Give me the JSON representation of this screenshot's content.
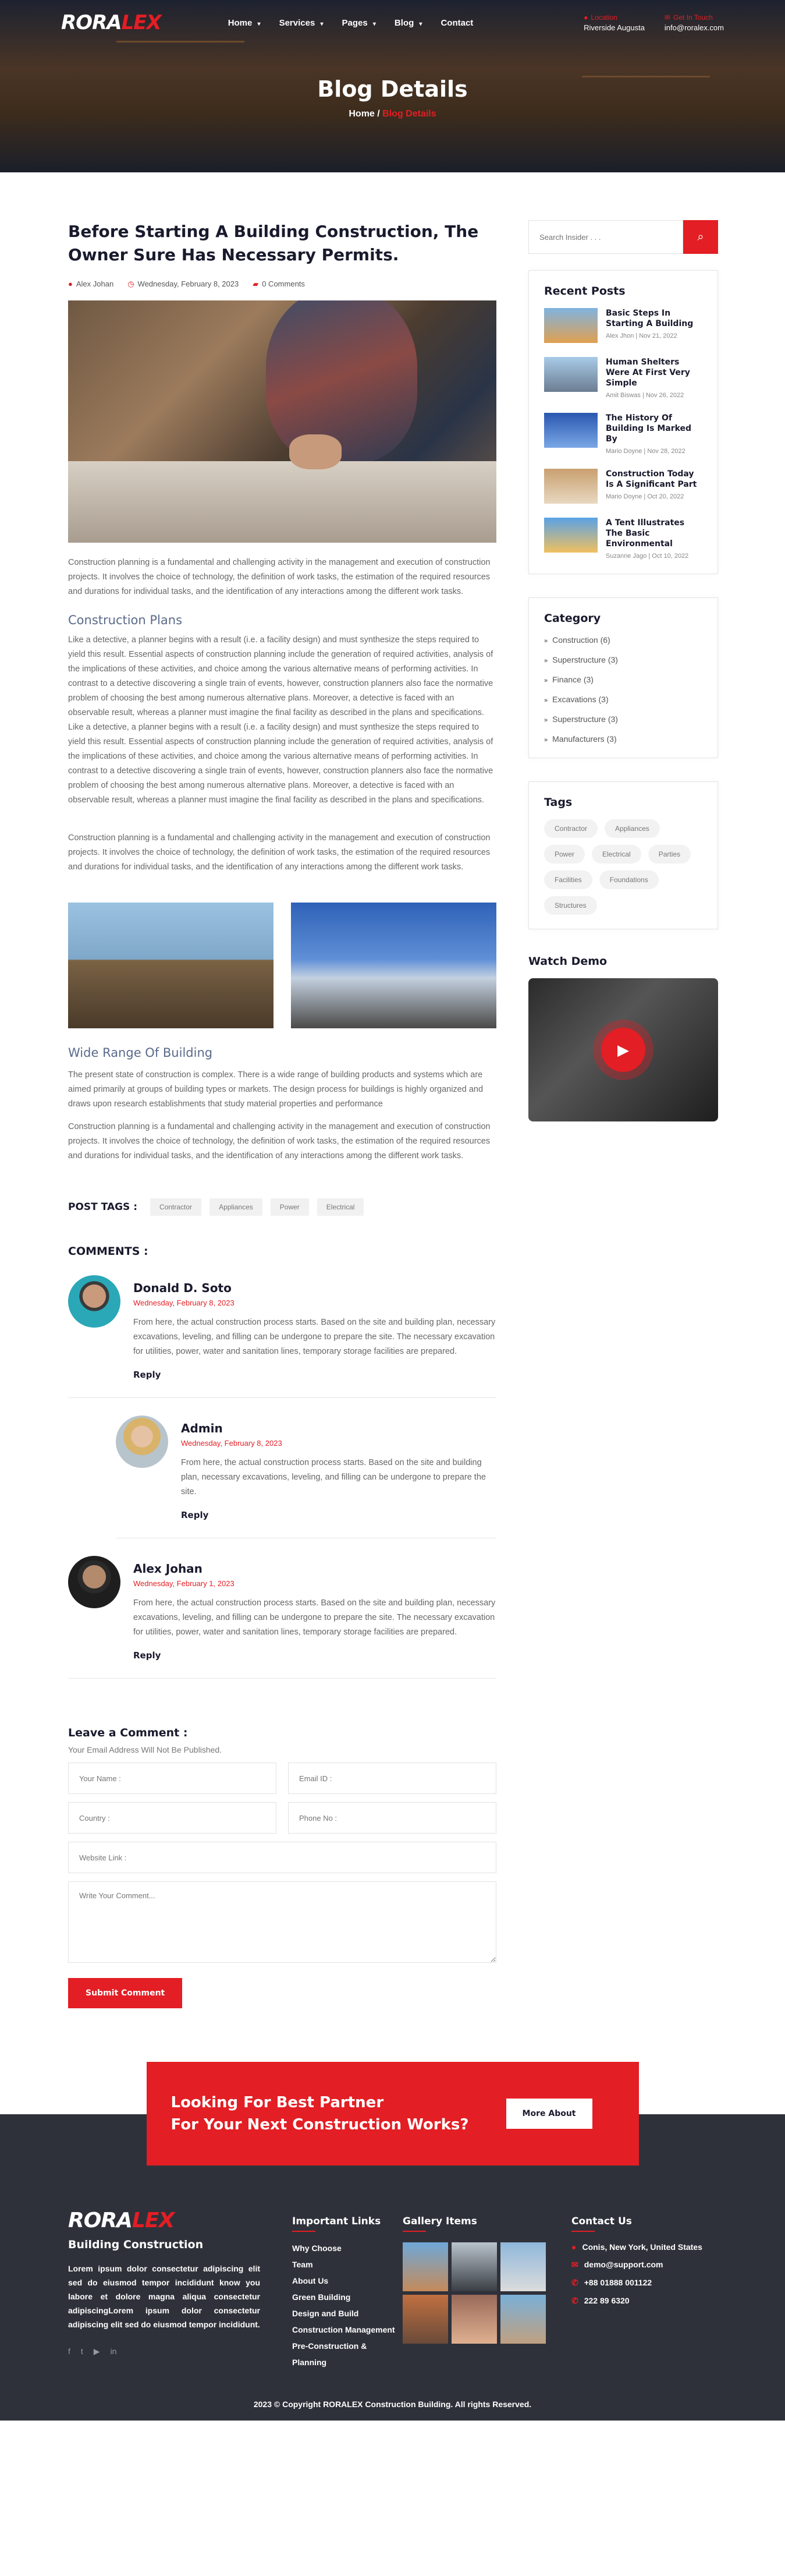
{
  "brand": {
    "logo_a": "RORA",
    "logo_b": "LEX"
  },
  "nav": [
    "Home",
    "Services",
    "Pages",
    "Blog",
    "Contact"
  ],
  "header_info": {
    "location_label": "Location",
    "location_value": "Riverside Augusta",
    "touch_label": "Get In Touch",
    "touch_value": "info@roralex.com"
  },
  "hero": {
    "title": "Blog Details",
    "crumb_home": "Home",
    "crumb_sep": "/",
    "crumb_current": "Blog Details"
  },
  "post": {
    "title": "Before Starting A Building Construction, The Owner Sure Has Necessary Permits.",
    "author": "Alex Johan",
    "date": "Wednesday, February 8, 2023",
    "comments": "0 Comments",
    "p1": "Construction planning is a fundamental and challenging activity in the management and execution of construction projects. It involves the choice of technology, the definition of work tasks, the estimation of the required resources and durations for individual tasks, and the identification of any interactions among the different work tasks.",
    "h_plans": "Construction Plans",
    "p2": "Like a detective, a planner begins with a result (i.e. a facility design) and must synthesize the steps required to yield this result. Essential aspects of construction planning include the generation of required activities, analysis of the implications of these activities, and choice among the various alternative means of performing activities. In contrast to a detective discovering a single train of events, however, construction planners also face the normative problem of choosing the best among numerous alternative plans. Moreover, a detective is faced with an observable result, whereas a planner must imagine the final facility as described in the plans and specifications. Like a detective, a planner begins with a result (i.e. a facility design) and must synthesize the steps required to yield this result. Essential aspects of construction planning include the generation of required activities, analysis of the implications of these activities, and choice among the various alternative means of performing activities. In contrast to a detective discovering a single train of events, however, construction planners also face the normative problem of choosing the best among numerous alternative plans. Moreover, a detective is faced with an observable result, whereas a planner must imagine the final facility as described in the plans and specifications.",
    "p3": "Construction planning is a fundamental and challenging activity in the management and execution of construction projects. It involves the choice of technology, the definition of work tasks, the estimation of the required resources and durations for individual tasks, and the identification of any interactions among the different work tasks.",
    "h_range": "Wide Range Of Building",
    "p4": "The present state of construction is complex. There is a wide range of building products and systems which are aimed primarily at groups of building types or markets. The design process for buildings is highly organized and draws upon research establishments that study material properties and performance",
    "p5": "Construction planning is a fundamental and challenging activity in the management and execution of construction projects. It involves the choice of technology, the definition of work tasks, the estimation of the required resources and durations for individual tasks, and the identification of any interactions among the different work tasks."
  },
  "post_tags": {
    "label": "POST TAGS :",
    "items": [
      "Contractor",
      "Appliances",
      "Power",
      "Electrical"
    ]
  },
  "comments": {
    "heading": "COMMENTS :",
    "reply_label": "Reply",
    "items": [
      {
        "name": "Donald D. Soto",
        "date": "Wednesday, February 8, 2023",
        "text": "From here, the actual construction process starts. Based on the site and building plan, necessary excavations, leveling, and filling can be undergone to prepare the site. The necessary excavation for utilities, power, water and sanitation lines, temporary storage facilities are prepared."
      },
      {
        "name": "Admin",
        "date": "Wednesday, February 8, 2023",
        "text": "From here, the actual construction process starts. Based on the site and building plan, necessary excavations, leveling, and filling can be undergone to prepare the site."
      },
      {
        "name": "Alex Johan",
        "date": "Wednesday, February 1, 2023",
        "text": "From here, the actual construction process starts. Based on the site and building plan, necessary excavations, leveling, and filling can be undergone to prepare the site. The necessary excavation for utilities, power, water and sanitation lines, temporary storage facilities are prepared."
      }
    ]
  },
  "form": {
    "heading": "Leave a Comment :",
    "sub": "Your Email Address Will Not Be Published.",
    "name_ph": "Your Name :",
    "email_ph": "Email ID :",
    "country_ph": "Country :",
    "phone_ph": "Phone No :",
    "website_ph": "Website Link :",
    "comment_ph": "Write Your Comment...",
    "submit": "Submit Comment"
  },
  "sidebar": {
    "search_ph": "Search Insider . . .",
    "recent_h": "Recent Posts",
    "recent": [
      {
        "title": "Basic Steps In Starting A Building",
        "meta": "Alex Jhon | Nov 21, 2022"
      },
      {
        "title": "Human Shelters Were At First Very Simple",
        "meta": "Amit Biswas | Nov 26, 2022"
      },
      {
        "title": "The History Of Building Is Marked By",
        "meta": "Mario Doyne | Nov 28, 2022"
      },
      {
        "title": "Construction Today Is A Significant Part",
        "meta": "Mario Doyne | Oct 20, 2022"
      },
      {
        "title": "A Tent Illustrates The Basic Environmental",
        "meta": "Suzanne Jago | Oct 10, 2022"
      }
    ],
    "category_h": "Category",
    "categories": [
      "Construction (6)",
      "Superstructure (3)",
      "Finance (3)",
      "Excavations (3)",
      "Superstructure (3)",
      "Manufacturers (3)"
    ],
    "tags_h": "Tags",
    "tags": [
      "Contractor",
      "Appliances",
      "Power",
      "Electrical",
      "Parties",
      "Facilities",
      "Foundations",
      "Structures"
    ],
    "watch_h": "Watch Demo"
  },
  "cta": {
    "line1": "Looking For Best Partner",
    "line2": "For Your Next Construction Works?",
    "button": "More About"
  },
  "footer": {
    "tagline": "Building Construction",
    "desc": "Lorem ipsum dolor consectetur adipiscing elit sed do eiusmod tempor incididunt know you labore et dolore magna aliqua consectetur adipiscingLorem ipsum dolor consectetur adipiscing elit sed do eiusmod tempor incididunt.",
    "links_h": "Important Links",
    "links": [
      "Why Choose",
      "Team",
      "About Us",
      "Green Building",
      "Design and Build",
      "Construction Management",
      "Pre-Construction & Planning"
    ],
    "gallery_h": "Gallery Items",
    "contact_h": "Contact Us",
    "address": "Conis, New York, United States",
    "email": "demo@support.com",
    "phone1": "+88 01888 001122",
    "phone2": "222 89 6320",
    "copyright": "2023 © Copyright RORALEX Construction Building. All rights Reserved."
  }
}
